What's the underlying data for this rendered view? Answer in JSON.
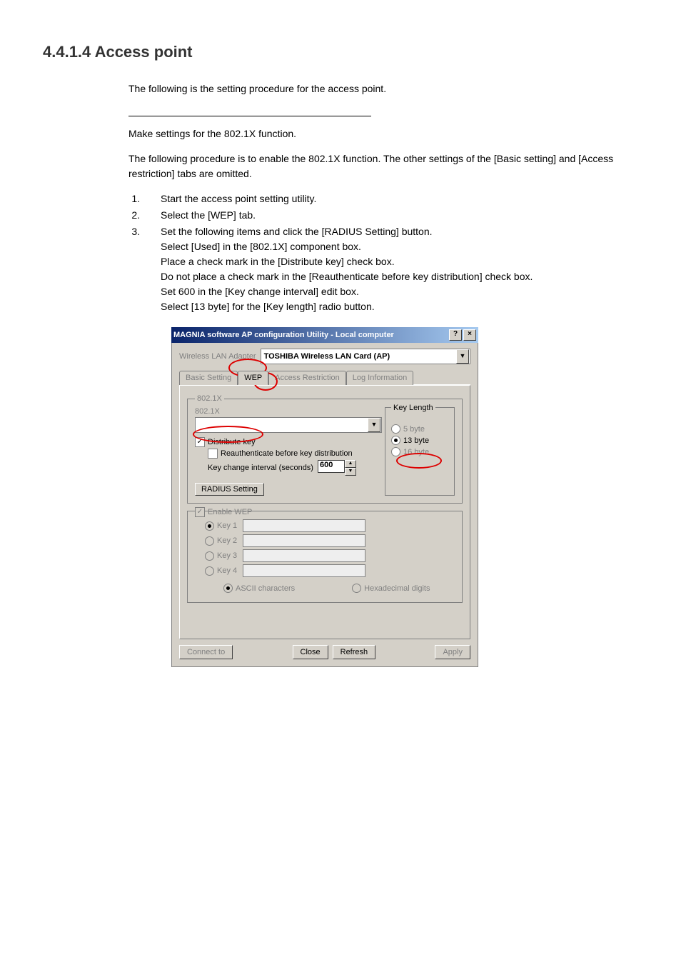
{
  "heading": "4.4.1.4 Access point",
  "intro": "The following is the setting procedure for the access point.",
  "make_settings": "Make settings for the 802.1X function.",
  "procedure_note": "The following procedure is to enable the 802.1X function.  The other settings of the [Basic setting] and [Access restriction] tabs are omitted.",
  "steps": {
    "s1": "Start the access point setting utility.",
    "s2": "Select the [WEP] tab.",
    "s3": "Set the following items and click the [RADIUS Setting] button.",
    "s3a": "Select [Used] in the [802.1X] component box.",
    "s3b": "Place a check mark in the [Distribute key] check box.",
    "s3c": "Do not place a check mark in the [Reauthenticate before key distribution] check box.",
    "s3d": "Set 600 in the [Key change interval] edit box.",
    "s3e": "Select [13 byte] for the [Key length] radio button."
  },
  "dialog": {
    "title": "MAGNIA software AP configuration Utility - Local computer",
    "help_btn": "?",
    "close_btn": "×",
    "adapter_label": "Wireless LAN Adapter",
    "adapter_value": "TOSHIBA Wireless LAN Card (AP)",
    "tabs": {
      "basic": "Basic Setting",
      "wep": "WEP",
      "access": "Access Restriction",
      "log": "Log Information"
    },
    "group_8021x": {
      "legend": "802.1X",
      "combo_label": "802.1X",
      "distribute": "Distribute key",
      "reauth": "Reauthenticate before key distribution",
      "interval_label": "Key change interval (seconds)",
      "interval_value": "600",
      "radius_btn": "RADIUS Setting"
    },
    "keylen": {
      "legend": "Key Length",
      "opt5": "5 byte",
      "opt13": "13 byte",
      "opt16": "16 byte"
    },
    "wep": {
      "enable": "Enable WEP",
      "key1": "Key 1",
      "key2": "Key 2",
      "key3": "Key 3",
      "key4": "Key 4",
      "ascii": "ASCII characters",
      "hex": "Hexadecimal digits"
    },
    "buttons": {
      "connect": "Connect to",
      "close": "Close",
      "refresh": "Refresh",
      "apply": "Apply"
    }
  }
}
